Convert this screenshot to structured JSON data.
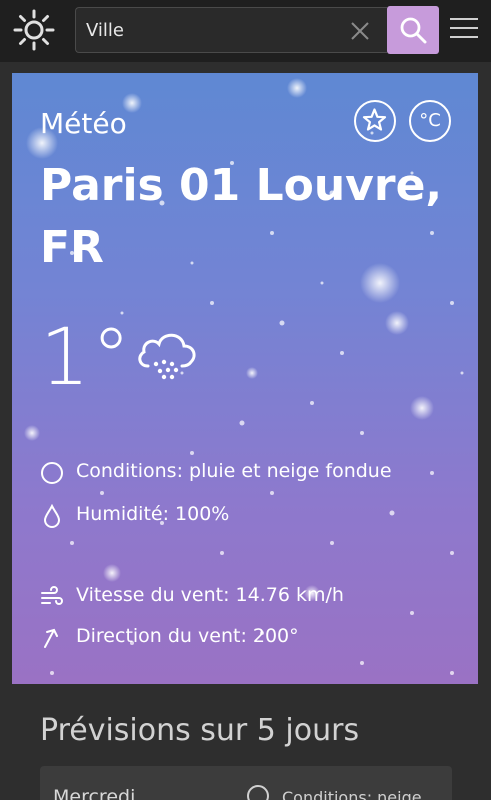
{
  "header": {
    "search_placeholder": "Ville",
    "search_value": ""
  },
  "weather": {
    "label": "Météo",
    "city": "Paris 01 Louvre, FR",
    "temperature": "1°",
    "unit_label": "°C",
    "condition_icon": "snow-cloud-icon",
    "details": {
      "conditions": "Conditions: pluie et neige fondue",
      "humidity": "Humidité: 100%",
      "wind_speed": "Vitesse du vent: 14.76 km/h",
      "wind_direction": "Direction du vent: 200°"
    }
  },
  "forecast": {
    "title": "Prévisions sur 5 jours",
    "days": [
      {
        "day": "Mercredi",
        "conditions": "Conditions: neige"
      }
    ]
  },
  "colors": {
    "accent": "#c79bdb",
    "topbar": "#1f1f1f",
    "background": "#2e2e2e",
    "card_gradient_top": "#5f88d3",
    "card_gradient_bottom": "#9a72c4"
  }
}
